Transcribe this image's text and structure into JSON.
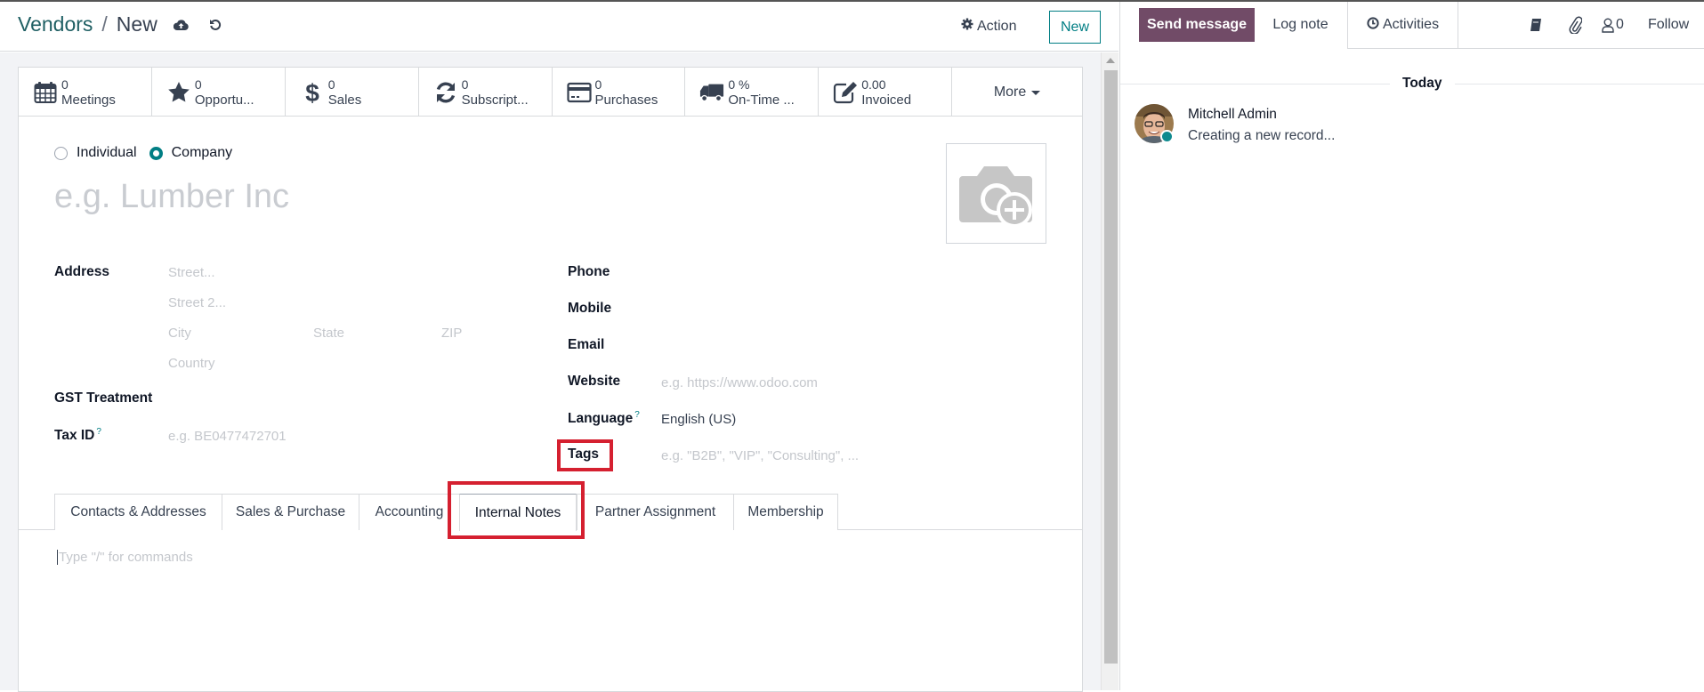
{
  "control_panel": {
    "breadcrumb_parent": "Vendors",
    "breadcrumb_separator": "/",
    "breadcrumb_current": "New",
    "save_icon": "cloud-upload-icon",
    "discard_icon": "undo-icon",
    "action_label": "Action",
    "new_label": "New"
  },
  "stat_buttons": [
    {
      "icon": "calendar-icon",
      "value": "0",
      "label": "Meetings"
    },
    {
      "icon": "star-icon",
      "value": "0",
      "label": "Opportu..."
    },
    {
      "icon": "dollar-icon",
      "value": "0",
      "label": "Sales"
    },
    {
      "icon": "refresh-icon",
      "value": "0",
      "label": "Subscript..."
    },
    {
      "icon": "credit-card-icon",
      "value": "0",
      "label": "Purchases"
    },
    {
      "icon": "truck-icon",
      "value": "0 %",
      "label": "On-Time ..."
    },
    {
      "icon": "edit-icon",
      "value": "0.00",
      "label": "Invoiced"
    }
  ],
  "more_label": "More",
  "company_type": {
    "options": [
      "Individual",
      "Company"
    ],
    "selected": "Company"
  },
  "name_placeholder": "e.g. Lumber Inc",
  "left_fields": {
    "address_label": "Address",
    "street_placeholder": "Street...",
    "street2_placeholder": "Street 2...",
    "city_placeholder": "City",
    "state_placeholder": "State",
    "zip_placeholder": "ZIP",
    "country_placeholder": "Country",
    "gst_label": "GST Treatment",
    "taxid_label": "Tax ID",
    "taxid_help": "?",
    "taxid_placeholder": "e.g. BE0477472701"
  },
  "right_fields": {
    "phone_label": "Phone",
    "mobile_label": "Mobile",
    "email_label": "Email",
    "website_label": "Website",
    "website_placeholder": "e.g. https://www.odoo.com",
    "language_label": "Language",
    "language_help": "?",
    "language_value": "English (US)",
    "tags_label": "Tags",
    "tags_placeholder": "e.g. \"B2B\", \"VIP\", \"Consulting\", ..."
  },
  "tabs": [
    {
      "label": "Contacts & Addresses",
      "active": false
    },
    {
      "label": "Sales & Purchase",
      "active": false
    },
    {
      "label": "Accounting",
      "active": false
    },
    {
      "label": "Internal Notes",
      "active": true
    },
    {
      "label": "Partner Assignment",
      "active": false
    },
    {
      "label": "Membership",
      "active": false
    }
  ],
  "editor_placeholder": "Type \"/\" for commands",
  "chatter": {
    "send_message": "Send message",
    "log_note": "Log note",
    "activities": "Activities",
    "followers_count": "0",
    "follow": "Follow",
    "date_separator": "Today",
    "messages": [
      {
        "author": "Mitchell Admin",
        "body": "Creating a new record...",
        "online": true
      }
    ]
  },
  "colors": {
    "brand": "#714b67",
    "accent": "#017e84",
    "highlight": "#d52030"
  }
}
